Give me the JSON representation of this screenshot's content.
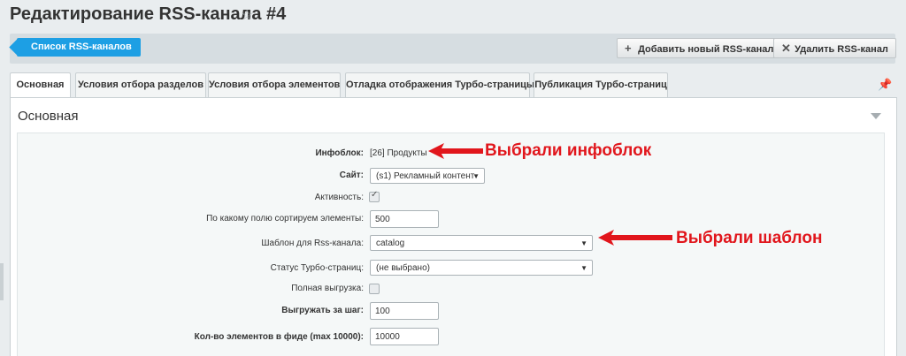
{
  "page": {
    "title": "Редактирование RSS-канала #4"
  },
  "toolbar": {
    "list_button": "Список RSS-каналов",
    "add_button": "Добавить новый RSS-канал",
    "delete_button": "Удалить RSS-канал"
  },
  "tabs": [
    {
      "label": "Основная",
      "active": true
    },
    {
      "label": "Условия отбора разделов",
      "active": false
    },
    {
      "label": "Условия отбора элементов",
      "active": false
    },
    {
      "label": "Отладка отображения Турбо-страницы",
      "active": false
    },
    {
      "label": "Публикация Турбо-страниц",
      "active": false
    }
  ],
  "section": {
    "title": "Основная"
  },
  "form": {
    "infoblock": {
      "label": "Инфоблок:",
      "value": "[26] Продукты"
    },
    "site": {
      "label": "Сайт:",
      "value": "(s1) Рекламный контент"
    },
    "active": {
      "label": "Активность:",
      "checked": true
    },
    "sort_field": {
      "label": "По какому полю сортируем элементы:",
      "value": "500"
    },
    "template": {
      "label": "Шаблон для Rss-канала:",
      "value": "catalog"
    },
    "turbo_status": {
      "label": "Статус Турбо-страниц:",
      "value": "(не выбрано)"
    },
    "full_export": {
      "label": "Полная выгрузка:",
      "checked": false
    },
    "per_step": {
      "label": "Выгружать за шаг:",
      "value": "100"
    },
    "feed_count": {
      "label": "Кол-во элементов в фиде (max 10000):",
      "value": "10000"
    }
  },
  "annotations": {
    "infoblock_note": "Выбрали инфоблок",
    "template_note": "Выбрали шаблон"
  },
  "colors": {
    "accent_blue": "#1d9fe4",
    "annotation_red": "#e1161c"
  }
}
